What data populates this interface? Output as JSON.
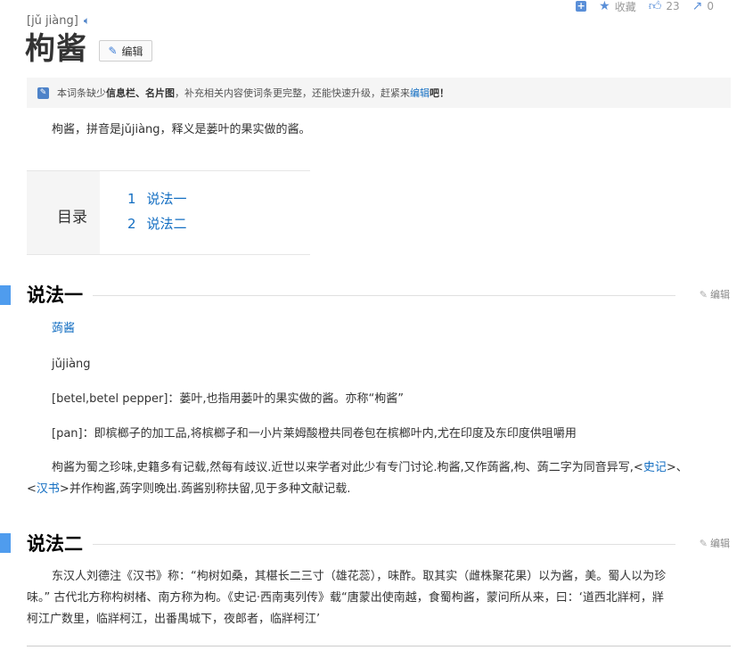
{
  "topbar": {
    "add_icon": "plus-square-icon",
    "collect_label": "收藏",
    "like_count": "23",
    "share_count": "0"
  },
  "header": {
    "pinyin": "[jǔ jiàng]",
    "title": "枸酱",
    "edit_label": "编辑"
  },
  "notice": {
    "prefix": "本词条缺少",
    "missing": "信息栏、名片图",
    "middle": "，补充相关内容使词条更完整，还能快速升级，赶紧来",
    "link": "编辑",
    "suffix": "吧！"
  },
  "summary": "枸酱，拼音是jǔjiàng，释义是蒌叶的果实做的酱。",
  "toc": {
    "title": "目录",
    "items": [
      {
        "num": "1",
        "label": "说法一"
      },
      {
        "num": "2",
        "label": "说法二"
      }
    ]
  },
  "section1": {
    "heading": "说法一",
    "edit_label": "编辑",
    "word_link": "蒟酱",
    "pinyin": "jǔjiàng",
    "def1": "[betel,betel pepper]：蒌叶,也指用蒌叶的果实做的酱。亦称“枸酱”",
    "def2": "[pan]：即槟榔子的加工品,将槟榔子和一小片莱姆酸橙共同卷包在槟榔叶内,尤在印度及东印度供咀嚼用",
    "para_a": "枸酱为蜀之珍味,史籍多有记载,然每有歧议.近世以来学者对此少有专门讨论.枸酱,又作蒟酱,枸、蒟二字为同音异写,<",
    "link_shiji": "史记",
    "para_b": ">、",
    "para_c": "<",
    "link_hanshu": "汉书",
    "para_d": ">并作枸酱,蒟字则晚出.蒟酱别称扶留,见于多种文献记载."
  },
  "section2": {
    "heading": "说法二",
    "edit_label": "编辑",
    "line1": "东汉人刘德注《汉书》称：“枸树如桑，其椹长二三寸（雄花蕊），味酢。取其实（雌株聚花果）以为酱，美。蜀人以为珍",
    "line2": "味。” 古代北方称构树楮、南方称为枸。《史记·西南夷列传》载“唐蒙出使南越，食蜀枸酱，蒙问所从来，曰：‘道西北牂柯，牂",
    "line3": "柯江广数里，临牂柯江，出番禺城下，夜郎者，临牂柯江’"
  }
}
